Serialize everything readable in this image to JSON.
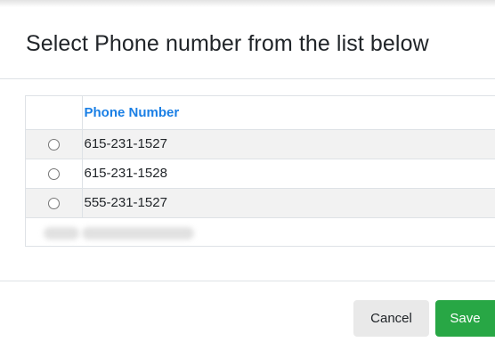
{
  "modal": {
    "title": "Select Phone number from the list below"
  },
  "table": {
    "columns": [
      "",
      "Phone Number"
    ],
    "rows": [
      {
        "phone": "615-231-1527",
        "selected": false
      },
      {
        "phone": "615-231-1528",
        "selected": false
      },
      {
        "phone": "555-231-1527",
        "selected": false
      }
    ]
  },
  "footer": {
    "cancel_label": "Cancel",
    "save_label": "Save"
  },
  "colors": {
    "header_link": "#1a7fe5",
    "save_button": "#28a745",
    "cancel_button": "#e9e9e9",
    "stripe": "#f2f2f2"
  }
}
